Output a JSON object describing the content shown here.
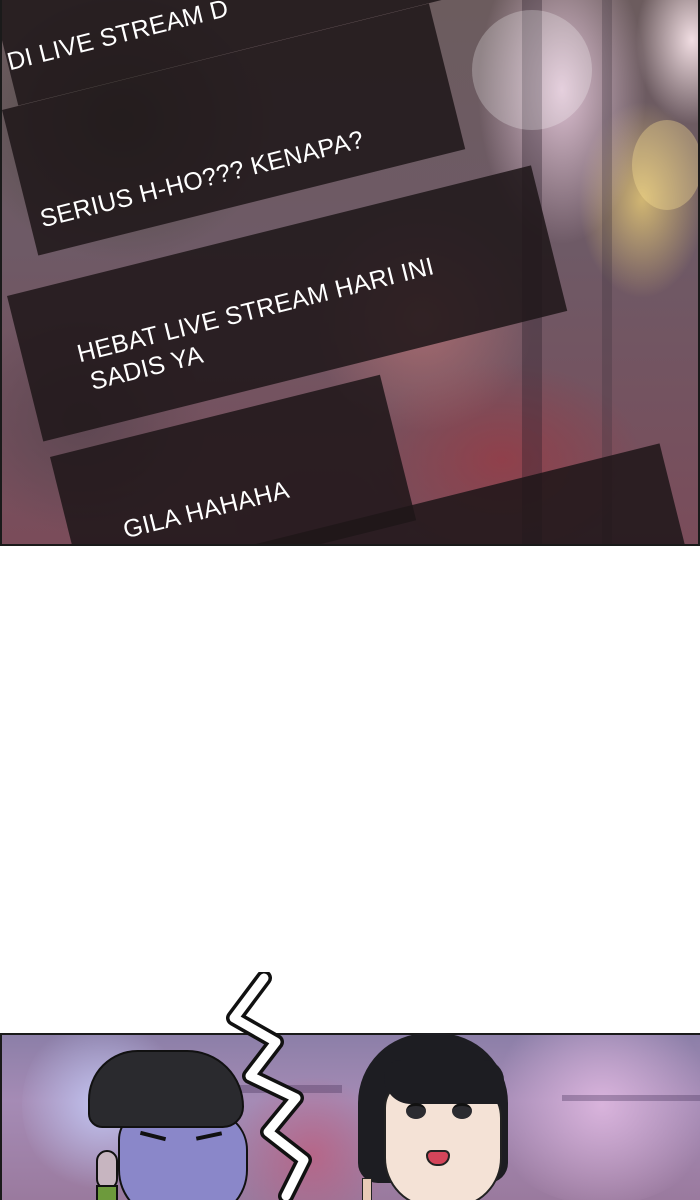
{
  "comments": [
    {
      "text": "DI LIVE STREAM D"
    },
    {
      "text": "SERIUS H-HO??? KENAPA?"
    },
    {
      "text_line1": "HEBAT LIVE STREAM HARI INI",
      "text_line2": "SADIS YA"
    },
    {
      "text": "GILA HAHAHA"
    }
  ],
  "colors": {
    "bubble": "#1e1618",
    "panel_border": "#1a1a1a",
    "page_background": "#ffffff"
  }
}
